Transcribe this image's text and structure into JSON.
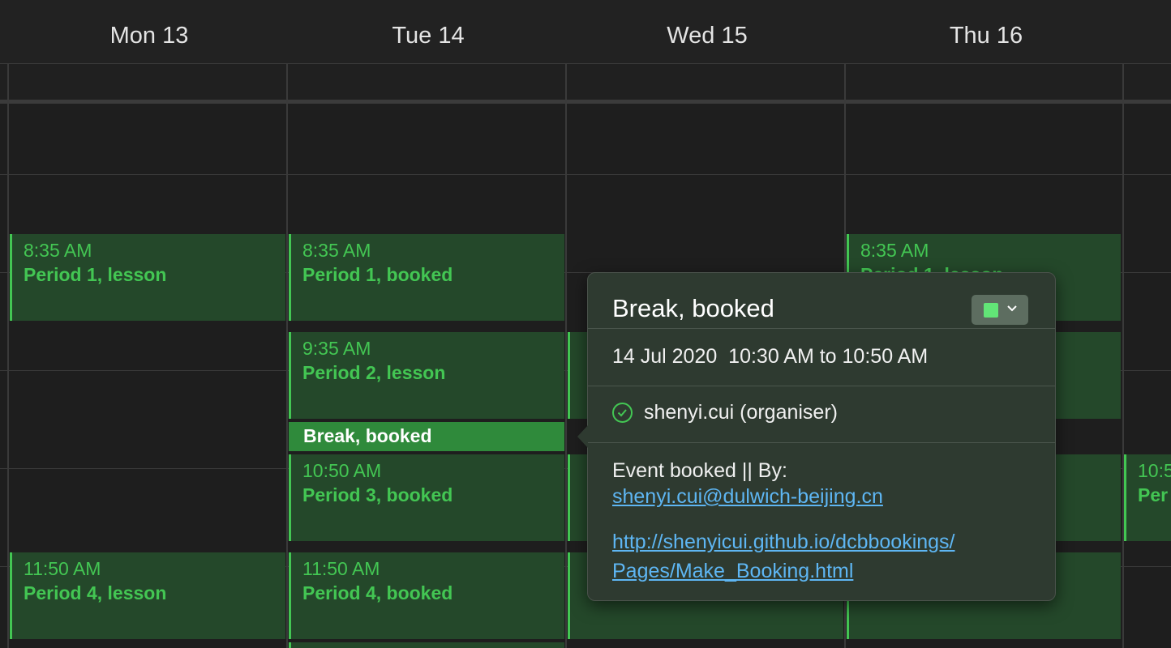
{
  "calendar": {
    "days": [
      {
        "label": "Mon 13"
      },
      {
        "label": "Tue 14"
      },
      {
        "label": "Wed 15"
      },
      {
        "label": "Thu 16"
      }
    ],
    "events": {
      "mon_p1": {
        "time": "8:35 AM",
        "name": "Period 1, lesson"
      },
      "mon_p4": {
        "time": "11:50 AM",
        "name": "Period 4, lesson"
      },
      "tue_p1": {
        "time": "8:35 AM",
        "name": "Period 1, booked"
      },
      "tue_p2": {
        "time": "9:35 AM",
        "name": "Period 2, lesson"
      },
      "tue_break": {
        "name": "Break, booked"
      },
      "tue_p3": {
        "time": "10:50 AM",
        "name": "Period 3, booked"
      },
      "tue_p4": {
        "time": "11:50 AM",
        "name": "Period 4, booked"
      },
      "thu_p1": {
        "time": "8:35 AM",
        "name": "Period 1, lesson"
      },
      "fri_p3": {
        "time": "10:5",
        "name": "Per"
      }
    },
    "event_color": "#43c653",
    "selected_color": "#2f8a3b"
  },
  "popover": {
    "title": "Break, booked",
    "date_range": "14 Jul 2020  10:30 AM to 10:50 AM",
    "attendee": "shenyi.cui (organiser)",
    "note_prefix": "Event booked || By:",
    "email": "shenyi.cui@dulwich-beijing.cn",
    "url_line1": "http://shenyicui.github.io/dcbbookings/",
    "url_line2": "Pages/Make_Booking.html",
    "swatch_color": "#62e577",
    "icons": {
      "attendee_status": "check-circle-icon",
      "color_menu": "chevron-down-icon"
    }
  }
}
